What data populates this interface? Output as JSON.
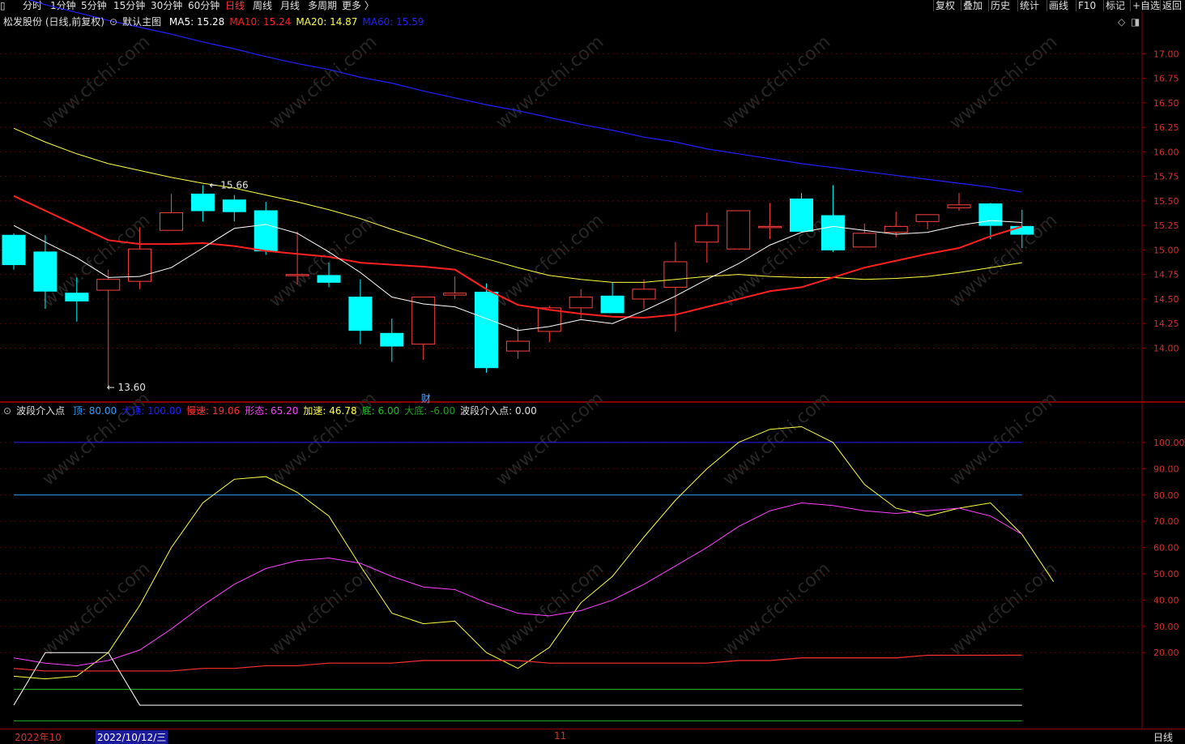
{
  "topbar": {
    "periods": [
      "分时",
      "1分钟",
      "5分钟",
      "15分钟",
      "30分钟",
      "60分钟",
      "日线",
      "周线",
      "月线",
      "多周期",
      "更多 〉"
    ],
    "active_period": "日线",
    "tools": [
      "复权",
      "叠加",
      "历史",
      "统计",
      "画线",
      "F10",
      "标记",
      "+自选",
      "返回"
    ]
  },
  "main_panel": {
    "stock_label": "松发股份 (日线,前复权)",
    "template_label": "默认主图",
    "ma": [
      {
        "name": "MA5",
        "value": "15.28",
        "color": "#ffffff"
      },
      {
        "name": "MA10",
        "value": "15.24",
        "color": "#ff2020"
      },
      {
        "name": "MA20",
        "value": "14.87",
        "color": "#ffff40"
      },
      {
        "name": "MA60",
        "value": "15.59",
        "color": "#2020ff"
      }
    ],
    "annotations": {
      "high_label": "15.66",
      "low_label": "13.60",
      "event_marker": "财"
    }
  },
  "indicator_panel": {
    "name": "波段介入点",
    "params": [
      {
        "name": "顶",
        "value": "80.00",
        "color": "#2aa0ff"
      },
      {
        "name": "大顶",
        "value": "100.00",
        "color": "#2020ff"
      },
      {
        "name": "慢速",
        "value": "19.06",
        "color": "#ff3030"
      },
      {
        "name": "形态",
        "value": "65.20",
        "color": "#ff40ff"
      },
      {
        "name": "加速",
        "value": "46.78",
        "color": "#ffff40"
      },
      {
        "name": "底",
        "value": "6.00",
        "color": "#20c020"
      },
      {
        "name": "大底",
        "value": "-6.00",
        "color": "#20a020"
      },
      {
        "name": "波段介入点",
        "value": "0.00",
        "color": "#e0e0e0"
      }
    ]
  },
  "bottombar": {
    "date_start": "2022年10",
    "date_cursor": "2022/10/12/三",
    "month_mark": "11",
    "period_label": "日线"
  },
  "watermark": "www.cfchi.com",
  "chart_data": [
    {
      "type": "candlestick",
      "y_ticks": [
        "17.00",
        "16.75",
        "16.50",
        "16.25",
        "16.00",
        "15.75",
        "15.50",
        "15.25",
        "15.00",
        "14.75",
        "14.50",
        "14.25",
        "14.00"
      ],
      "ylim": [
        13.5,
        17.3
      ],
      "candles": [
        [
          15.15,
          14.85,
          15.17,
          14.8
        ],
        [
          14.98,
          14.58,
          15.15,
          14.4
        ],
        [
          14.56,
          14.48,
          14.72,
          14.27
        ],
        [
          14.59,
          14.7,
          14.8,
          13.6
        ],
        [
          14.68,
          15.01,
          15.23,
          14.6
        ],
        [
          15.2,
          15.38,
          15.57,
          15.2
        ],
        [
          15.57,
          15.4,
          15.66,
          15.29
        ],
        [
          15.51,
          15.39,
          15.56,
          15.29
        ],
        [
          15.4,
          14.99,
          15.49,
          14.95
        ],
        [
          14.75,
          14.75,
          15.19,
          14.65
        ],
        [
          14.74,
          14.67,
          14.87,
          14.62
        ],
        [
          14.52,
          14.18,
          14.7,
          14.04
        ],
        [
          14.15,
          14.02,
          14.3,
          13.86
        ],
        [
          14.04,
          14.52,
          14.52,
          13.88
        ],
        [
          14.54,
          14.56,
          14.73,
          14.5
        ],
        [
          14.57,
          13.8,
          14.66,
          13.75
        ],
        [
          13.97,
          14.07,
          14.21,
          13.89
        ],
        [
          14.17,
          14.41,
          14.43,
          14.06
        ],
        [
          14.41,
          14.52,
          14.6,
          14.3
        ],
        [
          14.53,
          14.36,
          14.67,
          14.36
        ],
        [
          14.5,
          14.6,
          14.7,
          14.4
        ],
        [
          14.62,
          14.88,
          15.08,
          14.17
        ],
        [
          15.08,
          15.25,
          15.38,
          14.87
        ],
        [
          15.01,
          15.4,
          15.4,
          15.01
        ],
        [
          15.24,
          15.24,
          15.48,
          15.11
        ],
        [
          15.52,
          15.19,
          15.58,
          15.19
        ],
        [
          15.35,
          15.0,
          15.66,
          14.98
        ],
        [
          15.03,
          15.17,
          15.27,
          15.03
        ],
        [
          15.18,
          15.24,
          15.39,
          15.13
        ],
        [
          15.29,
          15.36,
          15.36,
          15.21
        ],
        [
          15.43,
          15.46,
          15.58,
          15.4
        ],
        [
          15.47,
          15.25,
          15.48,
          15.11
        ],
        [
          15.24,
          15.16,
          15.41,
          15.02
        ]
      ],
      "ma5": [
        15.25,
        15.08,
        14.92,
        14.72,
        14.73,
        14.82,
        15.02,
        15.22,
        15.26,
        15.17,
        14.98,
        14.77,
        14.52,
        14.45,
        14.42,
        14.3,
        14.18,
        14.22,
        14.29,
        14.25,
        14.38,
        14.53,
        14.7,
        14.86,
        15.05,
        15.18,
        15.24,
        15.2,
        15.16,
        15.18,
        15.25,
        15.3,
        15.28
      ],
      "ma10": [
        15.55,
        15.4,
        15.25,
        15.1,
        15.06,
        15.06,
        15.07,
        15.04,
        14.99,
        14.96,
        14.93,
        14.87,
        14.85,
        14.83,
        14.8,
        14.6,
        14.44,
        14.39,
        14.35,
        14.32,
        14.31,
        14.34,
        14.42,
        14.5,
        14.58,
        14.62,
        14.72,
        14.82,
        14.89,
        14.96,
        15.02,
        15.14,
        15.24
      ],
      "ma20": [
        16.24,
        16.1,
        15.98,
        15.88,
        15.81,
        15.74,
        15.68,
        15.63,
        15.56,
        15.49,
        15.41,
        15.32,
        15.21,
        15.11,
        15.0,
        14.91,
        14.82,
        14.74,
        14.7,
        14.67,
        14.67,
        14.7,
        14.73,
        14.75,
        14.73,
        14.72,
        14.72,
        14.7,
        14.71,
        14.73,
        14.77,
        14.82,
        14.87
      ],
      "ma60": [
        17.6,
        17.5,
        17.42,
        17.34,
        17.27,
        17.2,
        17.12,
        17.05,
        16.97,
        16.9,
        16.84,
        16.76,
        16.7,
        16.62,
        16.55,
        16.48,
        16.42,
        16.35,
        16.28,
        16.22,
        16.15,
        16.1,
        16.03,
        15.98,
        15.93,
        15.88,
        15.84,
        15.8,
        15.76,
        15.72,
        15.68,
        15.64,
        15.59
      ]
    },
    {
      "type": "line",
      "y_ticks": [
        "100.00",
        "90.00",
        "80.00",
        "70.00",
        "60.00",
        "50.00",
        "40.00",
        "30.00",
        "20.00"
      ],
      "ylim": [
        -8,
        108
      ],
      "hlines": {
        "顶": 80,
        "大顶": 100,
        "底": 6,
        "大底": -6
      },
      "series": [
        {
          "name": "加速",
          "values": [
            11,
            10,
            11,
            20,
            38,
            60,
            77,
            86,
            87,
            81,
            72,
            53,
            35,
            31,
            32,
            20,
            14,
            22,
            39,
            49,
            64,
            78,
            90,
            100,
            105,
            106,
            100,
            84,
            75,
            72,
            75,
            77,
            65,
            47
          ]
        },
        {
          "name": "形态",
          "values": [
            18,
            16,
            15,
            17,
            21,
            29,
            38,
            46,
            52,
            55,
            56,
            54,
            49,
            45,
            44,
            39,
            35,
            34,
            36,
            40,
            46,
            53,
            60,
            68,
            74,
            77,
            76,
            74,
            73,
            74,
            75,
            72,
            65
          ]
        },
        {
          "name": "慢速",
          "values": [
            14,
            13,
            13,
            13,
            13,
            13,
            14,
            14,
            15,
            15,
            16,
            16,
            16,
            17,
            17,
            17,
            17,
            16,
            16,
            16,
            16,
            16,
            16,
            17,
            17,
            18,
            18,
            18,
            18,
            19,
            19,
            19,
            19.06
          ]
        },
        {
          "name": "波段介入点",
          "values": [
            0,
            20,
            20,
            20,
            0,
            0,
            0,
            0,
            0,
            0,
            0,
            0,
            0,
            0,
            0,
            0,
            0,
            0,
            0,
            0,
            0,
            0,
            0,
            0,
            0,
            0,
            0,
            0,
            0,
            0,
            0,
            0,
            0
          ]
        }
      ]
    }
  ]
}
